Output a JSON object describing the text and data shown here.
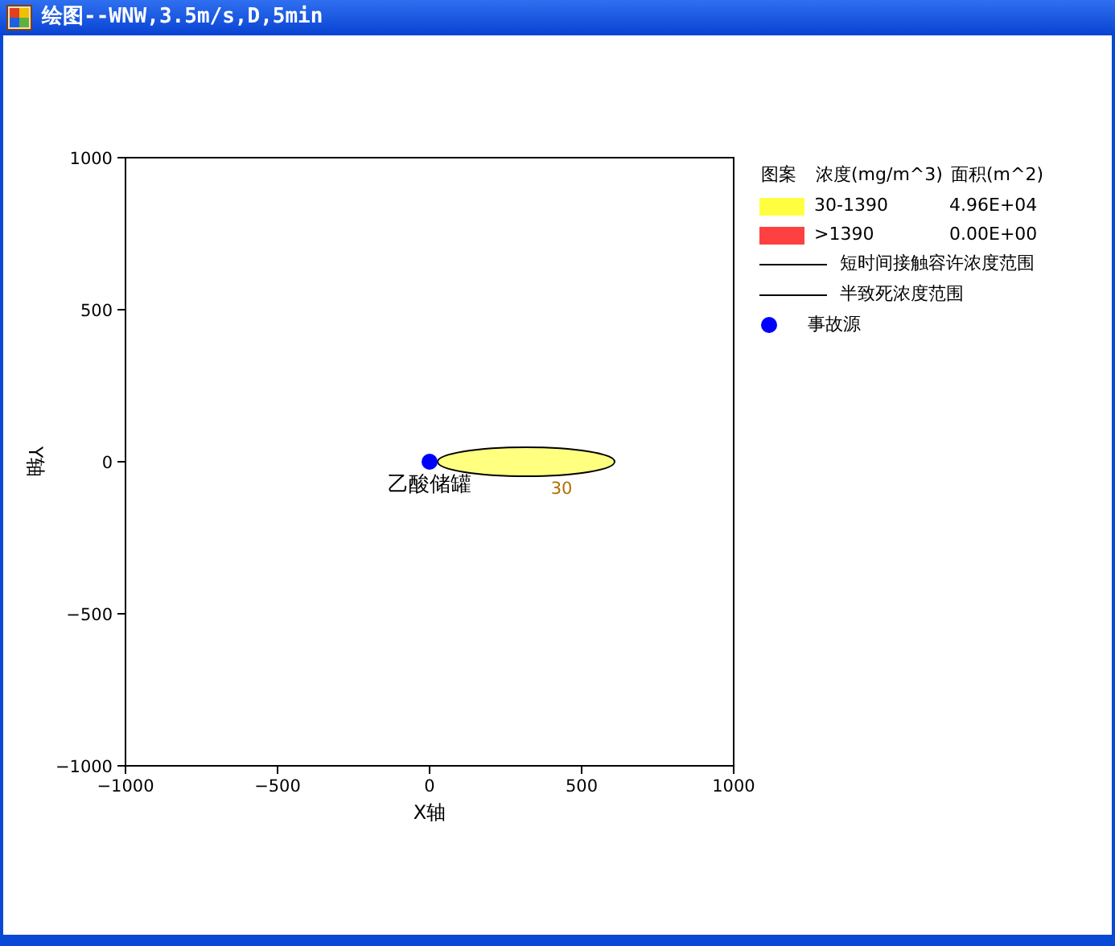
{
  "window": {
    "title": "绘图--WNW,3.5m/s,D,5min"
  },
  "plot": {
    "x_title": "X轴",
    "y_title": "Y轴",
    "x_ticks": [
      "−1000",
      "−500",
      "0",
      "500",
      "1000"
    ],
    "y_ticks": [
      "1000",
      "500",
      "0",
      "−500",
      "−1000"
    ],
    "source_label": "乙酸储罐",
    "contour_label": "30"
  },
  "legend": {
    "header": [
      "图案",
      "浓度(mg/m^3)",
      "面积(m^2)"
    ],
    "items": [
      {
        "kind": "swatch",
        "color": "#ffff40",
        "range": "30-1390",
        "area": "4.96E+04"
      },
      {
        "kind": "swatch",
        "color": "#ff4040",
        "range": ">1390",
        "area": "0.00E+00"
      },
      {
        "kind": "line",
        "label": "短时间接触容许浓度范围"
      },
      {
        "kind": "line",
        "label": "半致死浓度范围"
      },
      {
        "kind": "dot",
        "color": "#0000ff",
        "label": "事故源"
      }
    ]
  }
}
